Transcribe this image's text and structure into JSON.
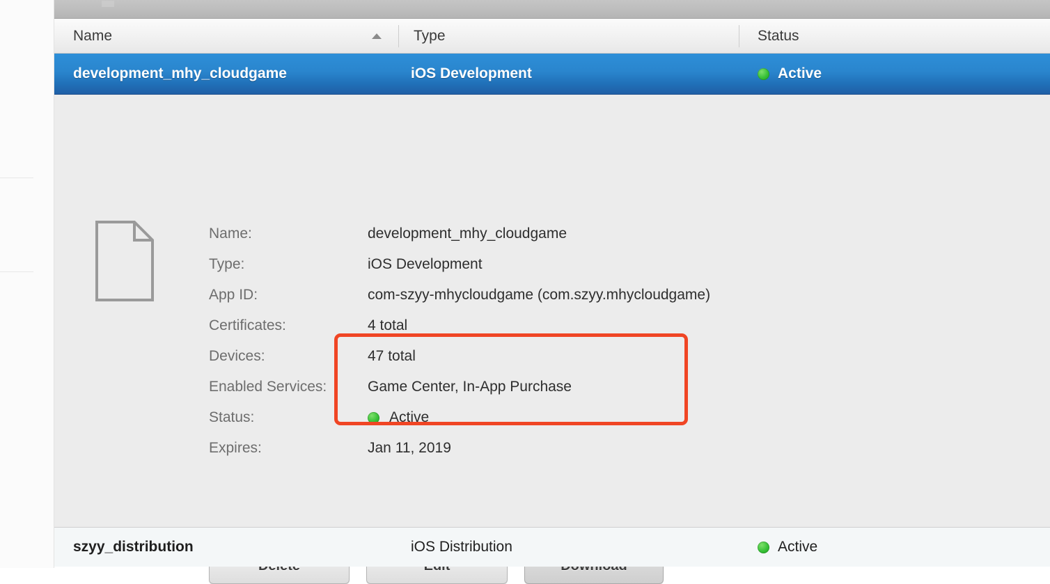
{
  "window": {
    "toolbar_strip": ""
  },
  "table": {
    "columns": [
      {
        "key": "name",
        "label": "Name",
        "sort": "ascending"
      },
      {
        "key": "type",
        "label": "Type"
      },
      {
        "key": "status",
        "label": "Status"
      }
    ],
    "rows": [
      {
        "name": "development_mhy_cloudgame",
        "type": "iOS Development",
        "status": "Active",
        "status_color": "#37c037",
        "selected": true
      },
      {
        "name": "szyy_distribution",
        "type": "iOS Distribution",
        "status": "Active",
        "status_color": "#37c037",
        "selected": false
      }
    ]
  },
  "detail": {
    "icon": "document-icon",
    "fields": [
      {
        "label": "Name:",
        "value": "development_mhy_cloudgame"
      },
      {
        "label": "Type:",
        "value": "iOS Development"
      },
      {
        "label": "App ID:",
        "value": "com-szyy-mhycloudgame (com.szyy.mhycloudgame)"
      },
      {
        "label": "Certificates:",
        "value": "4 total"
      },
      {
        "label": "Devices:",
        "value": "47 total"
      },
      {
        "label": "Enabled Services:",
        "value": "Game Center, In-App Purchase"
      },
      {
        "label": "Status:",
        "value": "Active",
        "has_status_dot": true
      },
      {
        "label": "Expires:",
        "value": "Jan 11, 2019"
      }
    ],
    "buttons": [
      {
        "label": "Delete",
        "state": "normal"
      },
      {
        "label": "Edit",
        "state": "normal"
      },
      {
        "label": "Download",
        "state": "pressed"
      }
    ]
  },
  "annotation": {
    "type": "highlight-rectangle",
    "color": "#f04524",
    "covers": [
      "Devices:",
      "Enabled Services:",
      "Status:"
    ]
  },
  "colors": {
    "selection_blue_top": "#2d8fd8",
    "selection_blue_bottom": "#1f5fa6",
    "panel_background": "#ececec",
    "status_green": "#37c037",
    "annotation_red": "#f04524"
  }
}
